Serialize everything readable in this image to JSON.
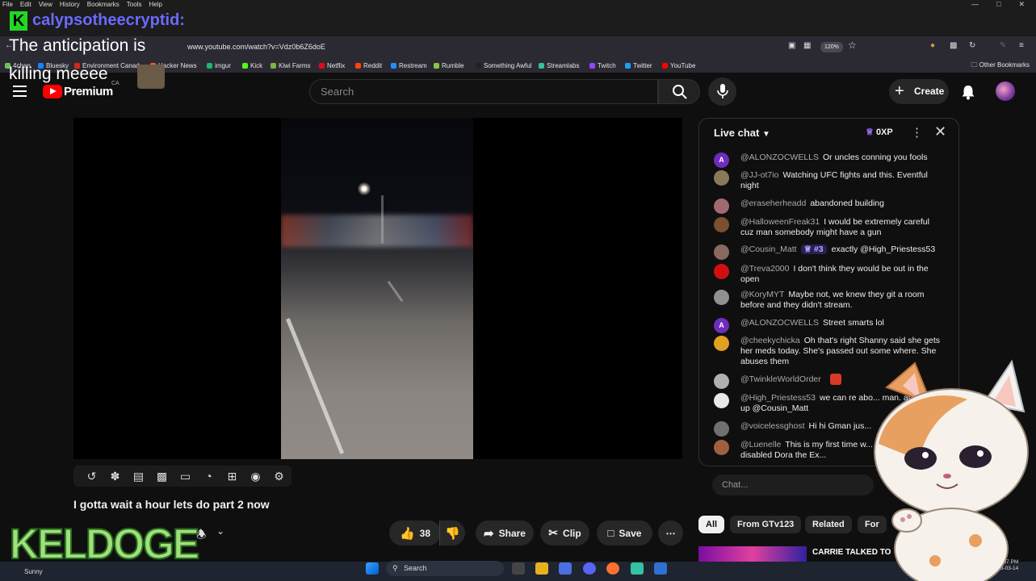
{
  "menubar": {
    "items": [
      "File",
      "Edit",
      "View",
      "History",
      "Bookmarks",
      "Tools",
      "Help"
    ]
  },
  "address": {
    "url": "www.youtube.com/watch?v=Vdz0b6Z6doE",
    "zoom": "120%"
  },
  "bookmarks": {
    "items": [
      {
        "label": "4chan",
        "color": "#6ec25a"
      },
      {
        "label": "Bluesky",
        "color": "#1185fe"
      },
      {
        "label": "Environment Canad...",
        "color": "#d62718"
      },
      {
        "label": "Hacker News",
        "color": "#ff6600"
      },
      {
        "label": "imgur",
        "color": "#1bb76e"
      },
      {
        "label": "Kick",
        "color": "#53fc18"
      },
      {
        "label": "Kiwi Farms",
        "color": "#7ab648"
      },
      {
        "label": "Netflix",
        "color": "#e50914"
      },
      {
        "label": "Reddit",
        "color": "#ff4500"
      },
      {
        "label": "Restream",
        "color": "#1e90ff"
      },
      {
        "label": "Rumble",
        "color": "#85c742"
      },
      {
        "label": "Something Awful",
        "color": "#222222"
      },
      {
        "label": "Streamlabs",
        "color": "#31c3a2"
      },
      {
        "label": "Twitch",
        "color": "#9146ff"
      },
      {
        "label": "Twitter",
        "color": "#1da1f2"
      },
      {
        "label": "YouTube",
        "color": "#ff0000"
      }
    ],
    "other": "Other Bookmarks"
  },
  "header": {
    "premium_label": "Premium",
    "region": "CA",
    "search_placeholder": "Search",
    "create_label": "Create"
  },
  "video": {
    "title": "I gotta wait a hour lets do part 2 now",
    "likes": "38",
    "share_label": "Share",
    "clip_label": "Clip",
    "save_label": "Save"
  },
  "chat": {
    "header": "Live chat",
    "xp": "0XP",
    "input_placeholder": "Chat...",
    "badge_rank": "#3",
    "messages": [
      {
        "initial": "A",
        "color": "#6f2dbd",
        "user": "@ALONZOCWELLS",
        "text": "Or uncles conning you fools"
      },
      {
        "initial": "",
        "color": "#8a7a5a",
        "user": "@JJ-ot7io",
        "text": "Watching UFC fights and this. Eventful night"
      },
      {
        "initial": "",
        "color": "#a06a70",
        "user": "@eraseherheadd",
        "text": "abandoned building"
      },
      {
        "initial": "",
        "color": "#7a5030",
        "user": "@HalloweenFreak31",
        "text": "I would be extremely careful cuz man somebody might have a gun"
      },
      {
        "initial": "",
        "color": "#8a6a60",
        "user": "@Cousin_Matt",
        "text": "exactly @High_Priestess53"
      },
      {
        "initial": "",
        "color": "#d01010",
        "user": "@Treva2000",
        "text": "I don't think they would be out in the open"
      },
      {
        "initial": "",
        "color": "#909090",
        "user": "@KoryMYT",
        "text": "Maybe not, we knew they git a room before and they didn't stream."
      },
      {
        "initial": "A",
        "color": "#6f2dbd",
        "user": "@ALONZOCWELLS",
        "text": "Street smarts lol"
      },
      {
        "initial": "",
        "color": "#e0a020",
        "user": "@cheekychicka",
        "text": "Oh that's right Shanny said she gets her meds today. She's passed out some where. She abuses them"
      },
      {
        "initial": "",
        "color": "#b0b0b0",
        "user": "@TwinkleWorldOrder",
        "text": ""
      },
      {
        "initial": "",
        "color": "#e8e8e8",
        "user": "@High_Priestess53",
        "text": "we can re abo... man. and what up @Cousin_Matt"
      },
      {
        "initial": "",
        "color": "#707070",
        "user": "@voicelessghost",
        "text": "Hi hi Gman jus..."
      },
      {
        "initial": "",
        "color": "#a06040",
        "user": "@Luenelle",
        "text": "This is my first time w... intellectually disabled Dora the Ex..."
      }
    ]
  },
  "chips": [
    "All",
    "From GTv123",
    "Related",
    "For"
  ],
  "recommended_title": "CARRIE TALKED TO",
  "taskbar": {
    "search": "Search",
    "weather": "Sunny",
    "time": "5:07 PM",
    "date": "2026-03-14"
  },
  "overlay": {
    "username": "calypsotheecryptid:",
    "message_line1": "The anticipation is",
    "message_line2": "killing meeee",
    "channel_logo": "KELDOGE"
  }
}
